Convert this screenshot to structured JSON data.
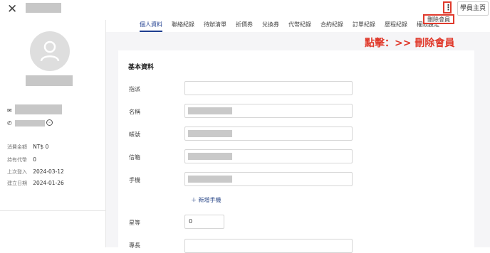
{
  "header": {
    "close_icon": "close-icon",
    "more_label": "⋮",
    "student_home_label": "學員主頁",
    "dropdown_delete_label": "刪除會員"
  },
  "annotation": "點擊：>> 刪除會員",
  "tabs": [
    {
      "label": "個人資料",
      "active": true
    },
    {
      "label": "聯絡紀錄"
    },
    {
      "label": "待辦清單"
    },
    {
      "label": "折價券"
    },
    {
      "label": "兌換券"
    },
    {
      "label": "代幣紀錄"
    },
    {
      "label": "合約紀錄"
    },
    {
      "label": "訂單紀錄"
    },
    {
      "label": "歷程紀錄"
    },
    {
      "label": "權限設定"
    }
  ],
  "sidebar": {
    "stats": [
      {
        "label": "消費金額",
        "value": "NT$ 0"
      },
      {
        "label": "持有代幣",
        "value": "0"
      },
      {
        "label": "上次登入",
        "value": "2024-03-12"
      },
      {
        "label": "建立日期",
        "value": "2024-01-26"
      }
    ]
  },
  "form": {
    "section_title": "基本資料",
    "fields": {
      "assign": "指派",
      "name": "名稱",
      "account": "帳號",
      "email": "信箱",
      "phone": "手機",
      "star": "星等",
      "specialty": "專長"
    },
    "add_phone_label": "＋ 新增手機",
    "star_value": "0"
  },
  "colors": {
    "accent": "#1e3d8f",
    "annotation": "#e03a2c",
    "background": "#f5f5f7"
  }
}
